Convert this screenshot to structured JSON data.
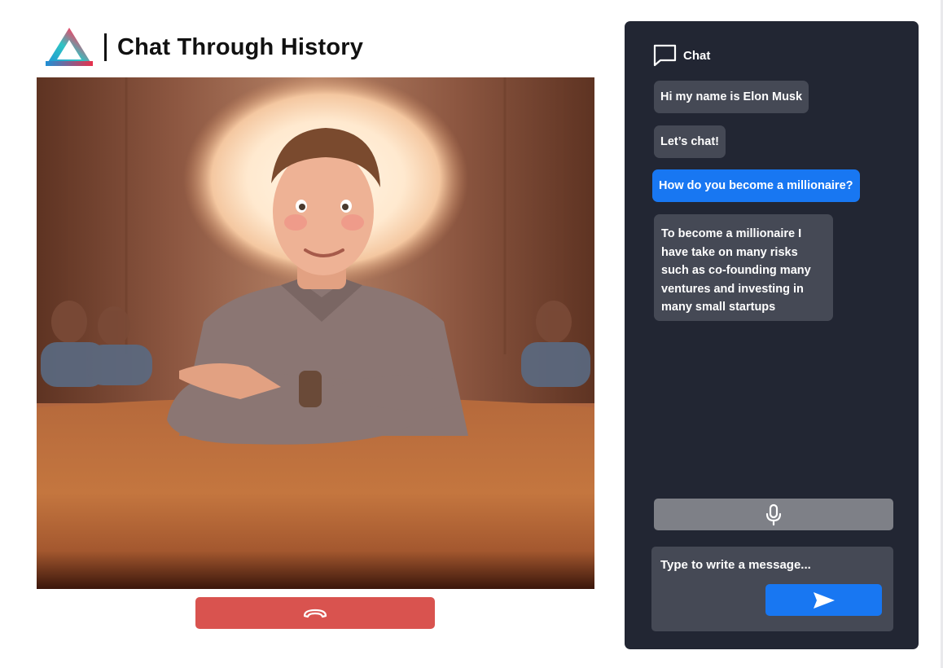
{
  "header": {
    "title": "Chat Through History",
    "logo_icon": "triangle-logo-icon"
  },
  "video": {
    "subject": "portrait-illustration",
    "end_call_icon": "phone-hangup-icon"
  },
  "chat": {
    "header_icon": "chat-bubble-icon",
    "header_label": "Chat",
    "messages": [
      {
        "role": "assistant",
        "text": "Hi my name is Elon Musk"
      },
      {
        "role": "assistant",
        "text": "Let’s chat!"
      },
      {
        "role": "user",
        "text": "How do you become a millionaire?"
      },
      {
        "role": "assistant",
        "lines": [
          "To become a millionaire I",
          "have take on many risks",
          "such as co-founding many",
          "ventures and investing in",
          "many small startups"
        ]
      }
    ],
    "mic_icon": "microphone-icon",
    "input_placeholder": "Type to write a message...",
    "send_icon": "send-icon"
  },
  "colors": {
    "panel_bg": "#222633",
    "bubble_assistant": "#454955",
    "bubble_user": "#1877f2",
    "end_call": "#d9534f",
    "mic_button": "#7e8087",
    "send_button": "#1877f2"
  }
}
